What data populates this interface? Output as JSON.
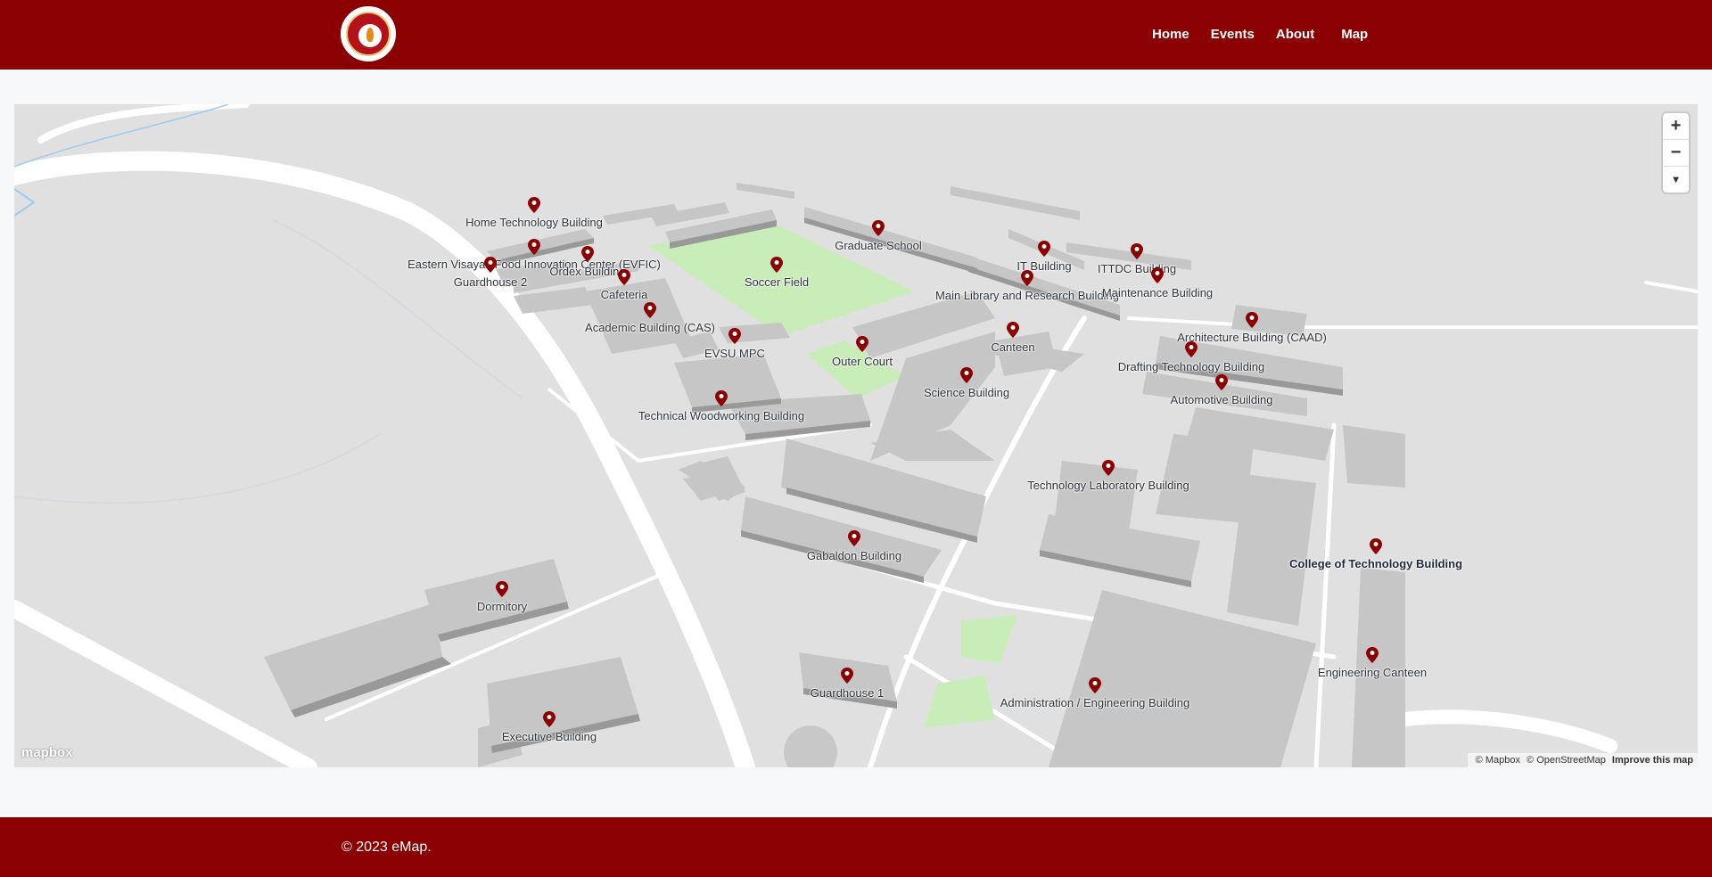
{
  "navbar": {
    "logo_icon": "university-seal-icon",
    "links": [
      "Home",
      "Events",
      "About",
      "Map"
    ]
  },
  "map": {
    "zoom_in": "+",
    "zoom_out": "−",
    "compass": "▾",
    "mapbox_logo": "mapbox",
    "attribution": {
      "mapbox": "© Mapbox",
      "osm": "© OpenStreetMap",
      "improve": "Improve this map"
    },
    "markers": [
      "Home Technology Building",
      "Eastern Visayas Food Innovation Center (EVFIC)",
      "Ordex Building",
      "Guardhouse 2",
      "Cafeteria",
      "Soccer Field",
      "Graduate School",
      "IT Building",
      "ITTDC Building",
      "Main Library and Research Building",
      "Maintenance Building",
      "Academic Building (CAS)",
      "EVSU MPC",
      "Outer Court",
      "Canteen",
      "Architecture Building (CAAD)",
      "Drafting Technology Building",
      "Science Building",
      "Automotive Building",
      "Technical Woodworking Building",
      "Technology Laboratory Building",
      "Gabaldon Building",
      "College of Technology Building",
      "Dormitory",
      "Guardhouse 1",
      "Engineering Canteen",
      "Administration / Engineering Building",
      "Executive Building"
    ]
  },
  "footer": {
    "text": "© 2023 eMap."
  },
  "colors": {
    "brand": "#8b0000",
    "pin": "#8b0000",
    "field": "#c8edb8",
    "building": "#c4c4c4"
  }
}
